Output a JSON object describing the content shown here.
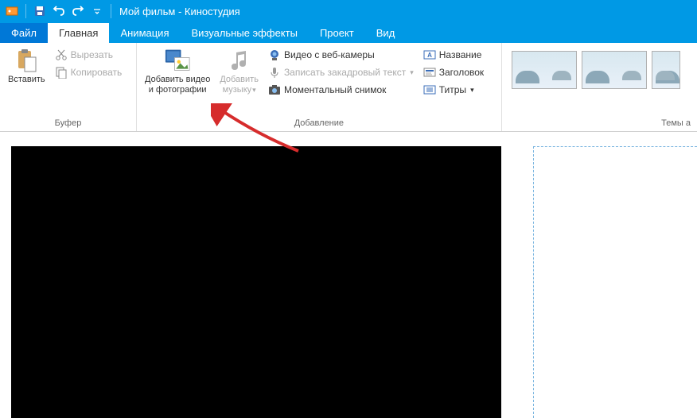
{
  "title": "Мой фильм - Киностудия",
  "tabs": {
    "file": "Файл",
    "home": "Главная",
    "animation": "Анимация",
    "effects": "Визуальные эффекты",
    "project": "Проект",
    "view": "Вид"
  },
  "ribbon": {
    "buffer": {
      "label": "Буфер",
      "paste": "Вставить",
      "cut": "Вырезать",
      "copy": "Копировать"
    },
    "adding": {
      "label": "Добавление",
      "add_media_line1": "Добавить видео",
      "add_media_line2": "и фотографии",
      "add_music_line1": "Добавить",
      "add_music_line2": "музыку",
      "webcam": "Видео с веб-камеры",
      "narration": "Записать закадровый текст",
      "snapshot": "Моментальный снимок",
      "title": "Название",
      "header": "Заголовок",
      "credits": "Титры"
    },
    "themes": {
      "label": "Темы а"
    }
  }
}
